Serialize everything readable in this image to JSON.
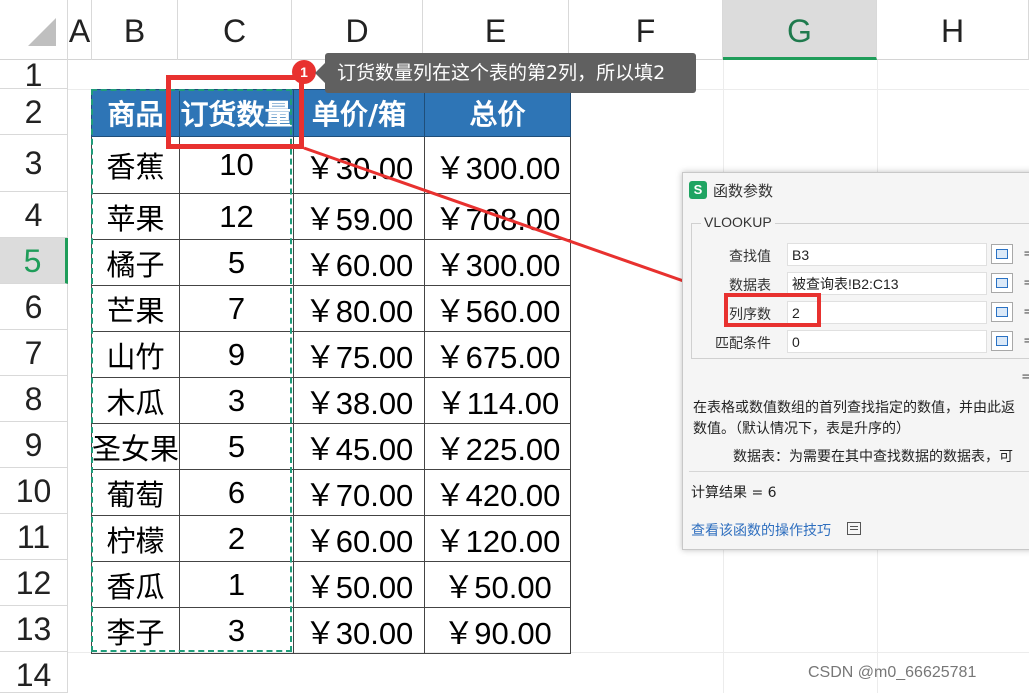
{
  "column_headers": [
    "A",
    "B",
    "C",
    "D",
    "E",
    "F",
    "G",
    "H"
  ],
  "selected_column": "G",
  "row_headers": [
    "1",
    "2",
    "3",
    "4",
    "5",
    "6",
    "7",
    "8",
    "9",
    "10",
    "11",
    "12",
    "13",
    "14"
  ],
  "selected_row": "5",
  "table": {
    "headers": [
      "商品",
      "订货数量",
      "单价/箱",
      "总价"
    ],
    "rows": [
      {
        "product": "香蕉",
        "qty": "10",
        "unit_price": "￥30.00",
        "total": "￥300.00"
      },
      {
        "product": "苹果",
        "qty": "12",
        "unit_price": "￥59.00",
        "total": "￥708.00"
      },
      {
        "product": "橘子",
        "qty": "5",
        "unit_price": "￥60.00",
        "total": "￥300.00"
      },
      {
        "product": "芒果",
        "qty": "7",
        "unit_price": "￥80.00",
        "total": "￥560.00"
      },
      {
        "product": "山竹",
        "qty": "9",
        "unit_price": "￥75.00",
        "total": "￥675.00"
      },
      {
        "product": "木瓜",
        "qty": "3",
        "unit_price": "￥38.00",
        "total": "￥114.00"
      },
      {
        "product": "圣女果",
        "qty": "5",
        "unit_price": "￥45.00",
        "total": "￥225.00"
      },
      {
        "product": "葡萄",
        "qty": "6",
        "unit_price": "￥70.00",
        "total": "￥420.00"
      },
      {
        "product": "柠檬",
        "qty": "2",
        "unit_price": "￥60.00",
        "total": "￥120.00"
      },
      {
        "product": "香瓜",
        "qty": "1",
        "unit_price": "￥50.00",
        "total": "￥50.00"
      },
      {
        "product": "李子",
        "qty": "3",
        "unit_price": "￥30.00",
        "total": "￥90.00"
      }
    ]
  },
  "callout": {
    "badge": "1",
    "text": "订货数量列在这个表的第2列，所以填2"
  },
  "dialog": {
    "title": "函数参数",
    "title_icon": "S",
    "function_name": "VLOOKUP",
    "args": [
      {
        "label": "查找值",
        "value": "B3",
        "eq": "="
      },
      {
        "label": "数据表",
        "value": "被查询表!B2:C13",
        "eq": "="
      },
      {
        "label": "列序数",
        "value": "2",
        "eq": "="
      },
      {
        "label": "匹配条件",
        "value": "0",
        "eq": "="
      }
    ],
    "eq_result": "=",
    "description_line1": "在表格或数值数组的首列查找指定的数值，并由此返",
    "description_line2": "数值。（默认情况下，表是升序的）",
    "param_description": "数据表：为需要在其中查找数据的数据表，可",
    "result": "计算结果 = 6",
    "help_link": "查看该函数的操作技巧"
  },
  "watermark": "CSDN @m0_66625781",
  "colors": {
    "header_blue": "#2e75b6",
    "highlight_red": "#e8312f",
    "selection_green": "#1f9d5a",
    "tooltip_gray": "#606060"
  }
}
